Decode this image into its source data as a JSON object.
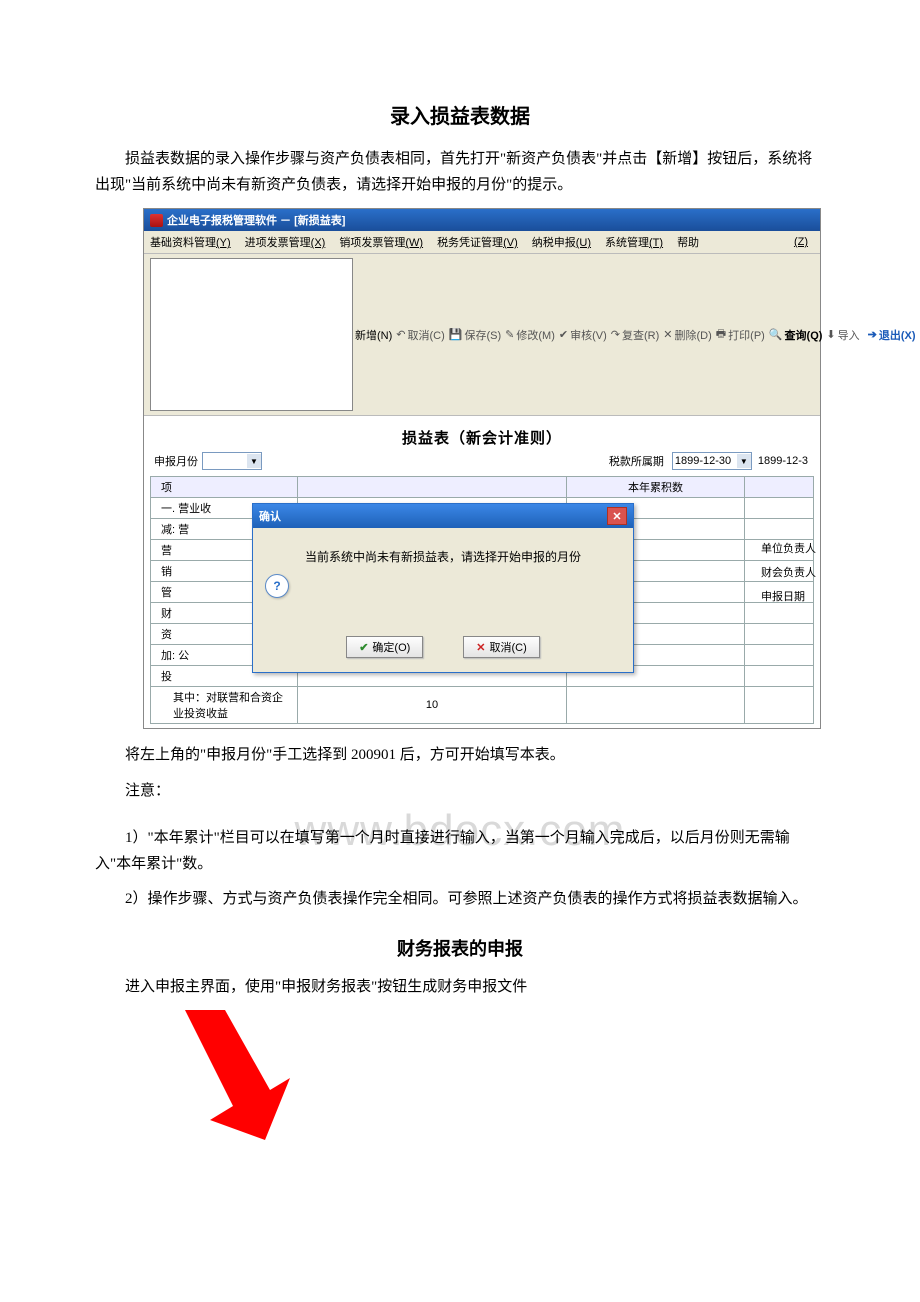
{
  "doc": {
    "title": "录入损益表数据",
    "para1": "损益表数据的录入操作步骤与资产负债表相同，首先打开\"新资产负债表\"并点击【新增】按钮后，系统将出现\"当前系统中尚未有新资产负债表，请选择开始申报的月份\"的提示。",
    "para2": "将左上角的\"申报月份\"手工选择到 200901 后，方可开始填写本表。",
    "note_label": "注意：",
    "note1": "1）\"本年累计\"栏目可以在填写第一个月时直接进行输入，当第一个月输入完成后，以后月份则无需输入\"本年累计\"数。",
    "note2": "2）操作步骤、方式与资产负债表操作完全相同。可参照上述资产负债表的操作方式将损益表数据输入。",
    "subtitle": "财务报表的申报",
    "para3": "进入申报主界面，使用\"申报财务报表\"按钮生成财务申报文件",
    "watermark": "www.bdocx.com"
  },
  "shot": {
    "window_title": "企业电子报税管理软件 － [新损益表]",
    "menu": {
      "m1": "基础资料管理",
      "m1k": "(Y)",
      "m2": "进项发票管理",
      "m2k": "(X)",
      "m3": "销项发票管理",
      "m3k": "(W)",
      "m4": "税务凭证管理",
      "m4k": "(V)",
      "m5": "纳税申报",
      "m5k": "(U)",
      "m6": "系统管理",
      "m6k": "(T)",
      "m7": "帮助",
      "z": "(Z)"
    },
    "toolbar": {
      "newdoc": "新增(N)",
      "cancel": "取消(C)",
      "save": "保存(S)",
      "edit": "修改(M)",
      "audit": "审核(V)",
      "review": "复查(R)",
      "del": "删除(D)",
      "print": "打印(P)",
      "query": "查询(Q)",
      "import": "导入",
      "exit": "退出(X)"
    },
    "form": {
      "title": "损益表（新会计准则）",
      "month_label": "申报月份",
      "period_label": "税款所属期",
      "date1": "1899-12-30",
      "date2": "1899-12-3",
      "col_item": "项",
      "col_acc": "本年累积数",
      "rows": {
        "r1": "一. 营业收",
        "r2": "减: 营",
        "r3": "营",
        "r4": "销",
        "r5": "管",
        "r6": "财",
        "r7": "资",
        "r8": "加: 公",
        "r9": "投",
        "r10": "其中：对联营和合资企业投资收益",
        "rownum10": "10"
      },
      "side": {
        "s1": "单位负责人",
        "s2": "财会负责人",
        "s3": "申报日期"
      }
    },
    "dialog": {
      "title": "确认",
      "msg": "当前系统中尚未有新损益表，请选择开始申报的月份",
      "ok": "确定(O)",
      "cancel": "取消(C)"
    }
  }
}
